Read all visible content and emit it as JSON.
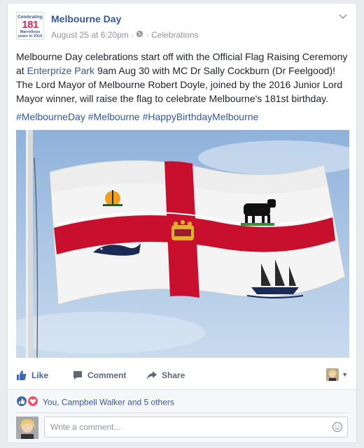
{
  "post": {
    "page_avatar": {
      "line1": "Celebrating",
      "line2": "181",
      "line3": "Marvellous",
      "line4": "years in 2016"
    },
    "page_name": "Melbourne Day",
    "date": "August 25 at 6:20pm",
    "separator": "·",
    "audience": "Celebrations",
    "text_part1": "Melbourne Day celebrations start off with the Official Flag Raising Ceremony at ",
    "link_text": "Enterprize Park",
    "text_part2": " 9am Aug 30 with MC Dr Sally Cockburn (Dr Feelgood)! The Lord Mayor of Melbourne Robert Doyle, joined by the 2016 Junior Lord Mayor winner, will raise the flag to celebrate Melbourne's 181st birthday.",
    "hashtags": [
      "#MelbourneDay",
      "#Melbourne",
      "#HappyBirthdayMelbourne"
    ]
  },
  "actions": {
    "like": "Like",
    "comment": "Comment",
    "share": "Share"
  },
  "reactions": {
    "summary": "You, Campbell Walker and 5 others"
  },
  "comment": {
    "placeholder": "Write a comment..."
  },
  "colors": {
    "link": "#365899",
    "muted": "#90949c",
    "like_blue": "#4267b2",
    "love_red": "#f25268"
  }
}
